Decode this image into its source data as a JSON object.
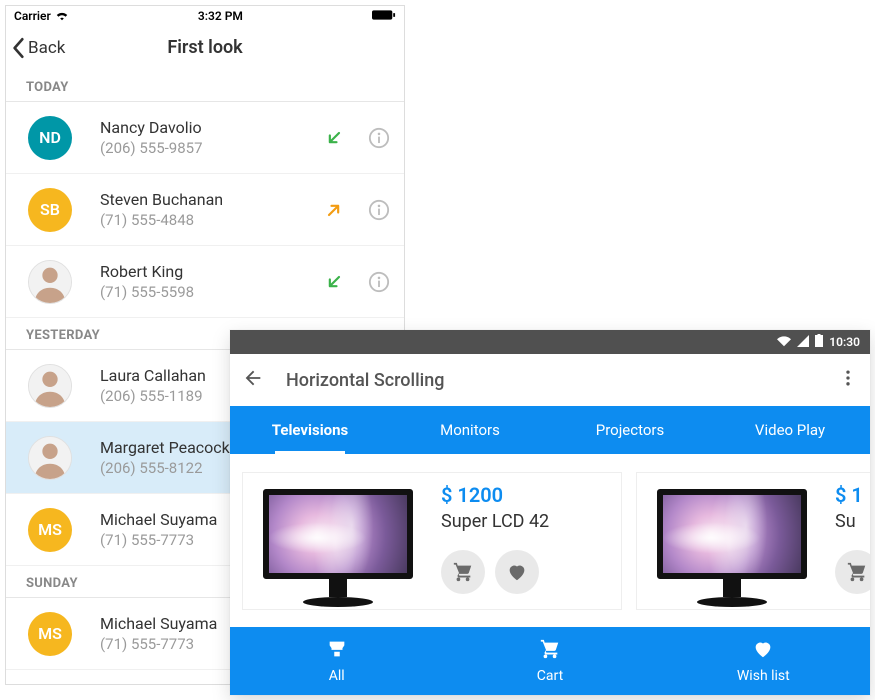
{
  "ios": {
    "status": {
      "carrier": "Carrier",
      "time": "3:32 PM"
    },
    "nav": {
      "back": "Back",
      "title": "First look"
    },
    "sections": [
      {
        "label": "TODAY",
        "rows": [
          {
            "initials": "ND",
            "color": "#0097a7",
            "name": "Nancy Davolio",
            "phone": "(206) 555-9857",
            "dir": "in",
            "photo": false
          },
          {
            "initials": "SB",
            "color": "#f6b71f",
            "name": "Steven Buchanan",
            "phone": "(71) 555-4848",
            "dir": "out",
            "photo": false
          },
          {
            "initials": "",
            "color": "#cfd8dc",
            "name": "Robert King",
            "phone": "(71) 555-5598",
            "dir": "in",
            "photo": true
          }
        ]
      },
      {
        "label": "YESTERDAY",
        "rows": [
          {
            "initials": "",
            "color": "#cfd8dc",
            "name": "Laura Callahan",
            "phone": "(206) 555-1189",
            "dir": "",
            "photo": true
          },
          {
            "initials": "",
            "color": "#cfd8dc",
            "name": "Margaret Peacock",
            "phone": "(206) 555-8122",
            "dir": "",
            "photo": true,
            "selected": true
          },
          {
            "initials": "MS",
            "color": "#f6b71f",
            "name": "Michael Suyama",
            "phone": "(71) 555-7773",
            "dir": "",
            "photo": false
          }
        ]
      },
      {
        "label": "SUNDAY",
        "rows": [
          {
            "initials": "MS",
            "color": "#f6b71f",
            "name": "Michael Suyama",
            "phone": "(71) 555-7773",
            "dir": "",
            "photo": false
          }
        ]
      }
    ]
  },
  "android": {
    "status": {
      "time": "10:30"
    },
    "appbar": {
      "title": "Horizontal Scrolling"
    },
    "tabs": [
      {
        "label": "Televisions",
        "active": true
      },
      {
        "label": "Monitors",
        "active": false
      },
      {
        "label": "Projectors",
        "active": false
      },
      {
        "label": "Video Play",
        "active": false
      }
    ],
    "products": [
      {
        "price": "$ 1200",
        "name": "Super LCD 42"
      },
      {
        "price": "$ 1",
        "name": "Su"
      }
    ],
    "bottomnav": [
      {
        "icon": "store",
        "label": "All"
      },
      {
        "icon": "cart",
        "label": "Cart"
      },
      {
        "icon": "heart",
        "label": "Wish list"
      }
    ]
  }
}
